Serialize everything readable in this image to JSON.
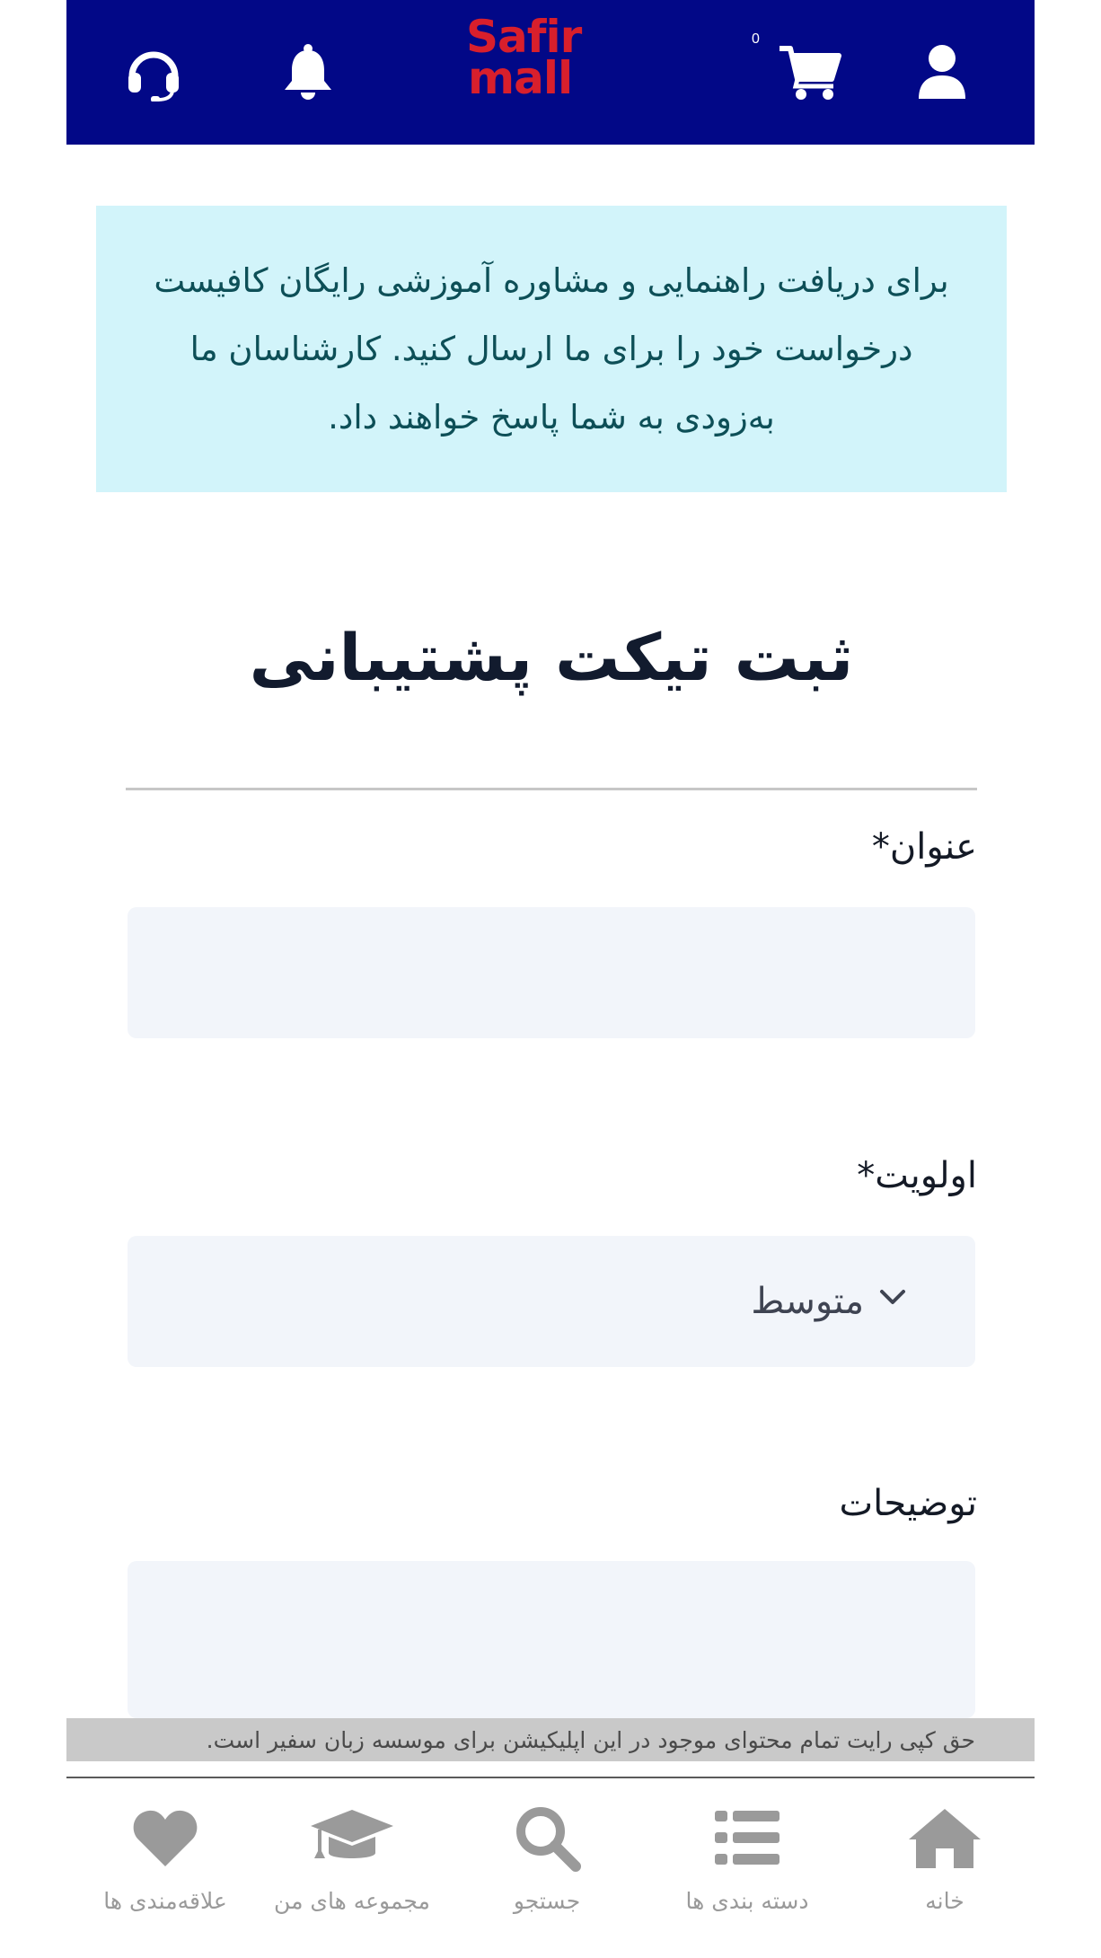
{
  "header": {
    "logo_line1": "Safir",
    "logo_line2": "mall",
    "cart_badge": "0",
    "icons": [
      "headset-icon",
      "bell-icon",
      "cart-icon",
      "user-icon"
    ]
  },
  "banner": {
    "text": "برای دریافت راهنمایی و مشاوره آموزشی رایگان کافیست درخواست خود را برای ما ارسال کنید. کارشناسان ما به‌زودی به شما پاسخ خواهند داد."
  },
  "page": {
    "title": "ثبت تیکت پشتیبانی"
  },
  "form": {
    "subject_label": "عنوان*",
    "subject_value": "",
    "priority_label": "اولویت*",
    "priority_value": "متوسط",
    "description_label": "توضیحات",
    "description_value": ""
  },
  "footer": {
    "copyright": "حق کپی رایت تمام محتوای موجود در این اپلیکیشن برای موسسه زبان سفیر است."
  },
  "nav": {
    "items": [
      {
        "label": "علاقه‌مندی ها",
        "icon": "heart-icon"
      },
      {
        "label": "مجموعه های من",
        "icon": "graduation-cap-icon"
      },
      {
        "label": "جستجو",
        "icon": "search-icon"
      },
      {
        "label": "دسته بندی ها",
        "icon": "list-icon"
      },
      {
        "label": "خانه",
        "icon": "home-icon"
      }
    ]
  },
  "colors": {
    "header_bg": "#020887",
    "logo": "#d81f2c",
    "banner_bg": "#d2f4fa",
    "banner_text": "#0d4f57",
    "field_bg": "#f2f5fa",
    "nav_icon": "#9a9a9a"
  }
}
